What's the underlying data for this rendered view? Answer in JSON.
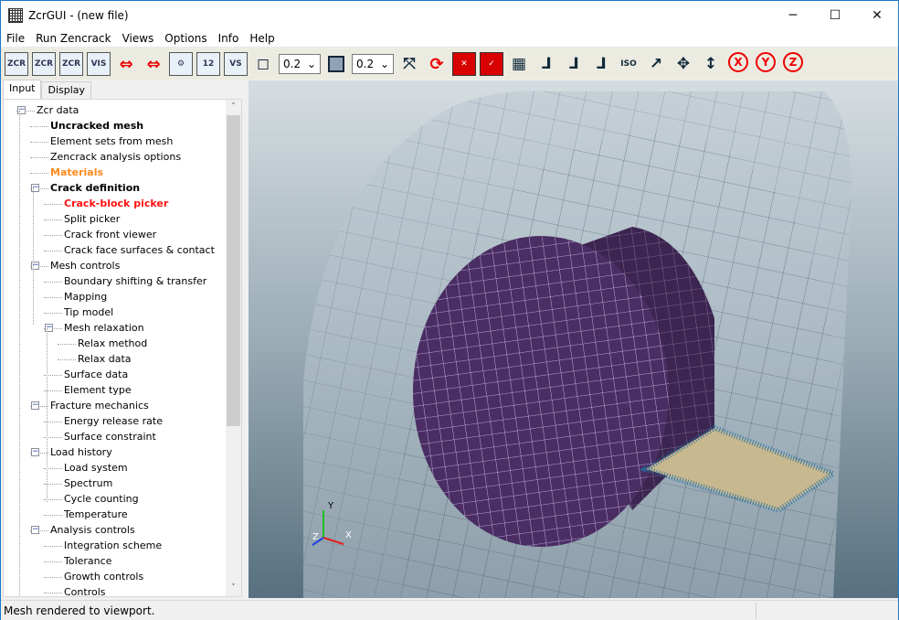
{
  "window": {
    "title": "ZcrGUI - (new file)",
    "minimize": "─",
    "maximize": "☐",
    "close": "✕"
  },
  "menu": [
    "File",
    "Run Zencrack",
    "Views",
    "Options",
    "Info",
    "Help"
  ],
  "toolbar": {
    "buttons_a": [
      {
        "name": "zcr-new-icon",
        "label": "ZCR",
        "mark": "+",
        "style": "box"
      },
      {
        "name": "zcr-open-icon",
        "label": "ZCR",
        "mark": "↘",
        "style": "box"
      },
      {
        "name": "zcr-save-icon",
        "label": "ZCR",
        "mark": "↘",
        "style": "box"
      },
      {
        "name": "vis-export-icon",
        "label": "VIS",
        "mark": "↘",
        "style": "box"
      },
      {
        "name": "mesh-block-icon",
        "label": "⇔",
        "mark": "",
        "style": "red"
      },
      {
        "name": "mesh-notch-icon",
        "label": "⇔",
        "mark": "",
        "style": "red"
      },
      {
        "name": "settings-gear-icon",
        "label": "⚙",
        "mark": "",
        "style": "box"
      },
      {
        "name": "shapes-icon",
        "label": "12",
        "mark": "",
        "style": "box"
      },
      {
        "name": "vs-icon",
        "label": "VS",
        "mark": "",
        "style": "box"
      },
      {
        "name": "wireframe-cube-icon",
        "label": "◻",
        "mark": "",
        "style": "dark"
      }
    ],
    "select1": "0.2",
    "solid_cube_icon": "solid-cube-icon",
    "select2": "0.2",
    "buttons_b": [
      {
        "name": "fit-to-view-icon",
        "label": "⤧",
        "style": "dark"
      },
      {
        "name": "rotate-center-icon",
        "label": "⟳",
        "style": "red"
      },
      {
        "name": "hide-elements-icon",
        "label": "✕",
        "style": "redbox"
      },
      {
        "name": "show-elements-icon",
        "label": "✓",
        "style": "redbox"
      },
      {
        "name": "mesh-grid-icon",
        "label": "▦",
        "style": "dark"
      },
      {
        "name": "view-xy-icon",
        "label": "⅃",
        "style": "dark"
      },
      {
        "name": "view-zy-icon",
        "label": "⅃",
        "style": "dark"
      },
      {
        "name": "view-xz-icon",
        "label": "⅃",
        "style": "dark"
      },
      {
        "name": "view-iso-icon",
        "label": "ISO",
        "style": "dark"
      },
      {
        "name": "curve-icon",
        "label": "↗",
        "style": "dark"
      },
      {
        "name": "pan-icon",
        "label": "✥",
        "style": "dark"
      },
      {
        "name": "zoom-vertical-icon",
        "label": "↕",
        "style": "dark"
      },
      {
        "name": "rotate-x-icon",
        "label": "X",
        "style": "redcircle"
      },
      {
        "name": "rotate-y-icon",
        "label": "Y",
        "style": "redcircle"
      },
      {
        "name": "rotate-z-icon",
        "label": "Z",
        "style": "redcircle"
      }
    ]
  },
  "tabs": [
    "Input",
    "Display"
  ],
  "tree": [
    {
      "label": "Zcr data",
      "level": 0,
      "expander": "−"
    },
    {
      "label": "Uncracked mesh",
      "level": 1,
      "bold": true
    },
    {
      "label": "Element sets from mesh",
      "level": 1
    },
    {
      "label": "Zencrack analysis options",
      "level": 1
    },
    {
      "label": "Materials",
      "level": 1,
      "bold": true,
      "color": "#ff8a1c"
    },
    {
      "label": "Crack definition",
      "level": 1,
      "bold": true,
      "expander": "−"
    },
    {
      "label": "Crack-block picker",
      "level": 2,
      "bold": true,
      "color": "#ff1010"
    },
    {
      "label": "Split picker",
      "level": 2
    },
    {
      "label": "Crack front viewer",
      "level": 2
    },
    {
      "label": "Crack face surfaces & contact",
      "level": 2
    },
    {
      "label": "Mesh controls",
      "level": 1,
      "expander": "−"
    },
    {
      "label": "Boundary shifting & transfer",
      "level": 2
    },
    {
      "label": "Mapping",
      "level": 2
    },
    {
      "label": "Tip model",
      "level": 2
    },
    {
      "label": "Mesh relaxation",
      "level": 2,
      "expander": "−"
    },
    {
      "label": "Relax method",
      "level": 3
    },
    {
      "label": "Relax data",
      "level": 3
    },
    {
      "label": "Surface data",
      "level": 2
    },
    {
      "label": "Element type",
      "level": 2
    },
    {
      "label": "Fracture mechanics",
      "level": 1,
      "expander": "−"
    },
    {
      "label": "Energy release rate",
      "level": 2
    },
    {
      "label": "Surface constraint",
      "level": 2
    },
    {
      "label": "Load history",
      "level": 1,
      "expander": "−"
    },
    {
      "label": "Load system",
      "level": 2
    },
    {
      "label": "Spectrum",
      "level": 2
    },
    {
      "label": "Cycle counting",
      "level": 2
    },
    {
      "label": "Temperature",
      "level": 2
    },
    {
      "label": "Analysis controls",
      "level": 1,
      "expander": "−"
    },
    {
      "label": "Integration scheme",
      "level": 2
    },
    {
      "label": "Tolerance",
      "level": 2
    },
    {
      "label": "Growth controls",
      "level": 2
    },
    {
      "label": "Controls",
      "level": 2
    }
  ],
  "scroll": {
    "up": "˄",
    "down": "˅"
  },
  "axes": {
    "x": "X",
    "y": "Y",
    "z": "Z"
  },
  "colors": {
    "cylinder": "#4a2d63",
    "mesh_line": "#d8c8f0",
    "crack": "#c8b890",
    "axis_x": "#e02020",
    "axis_y": "#20c020",
    "axis_z": "#2040e0"
  },
  "status": "Mesh rendered to viewport."
}
